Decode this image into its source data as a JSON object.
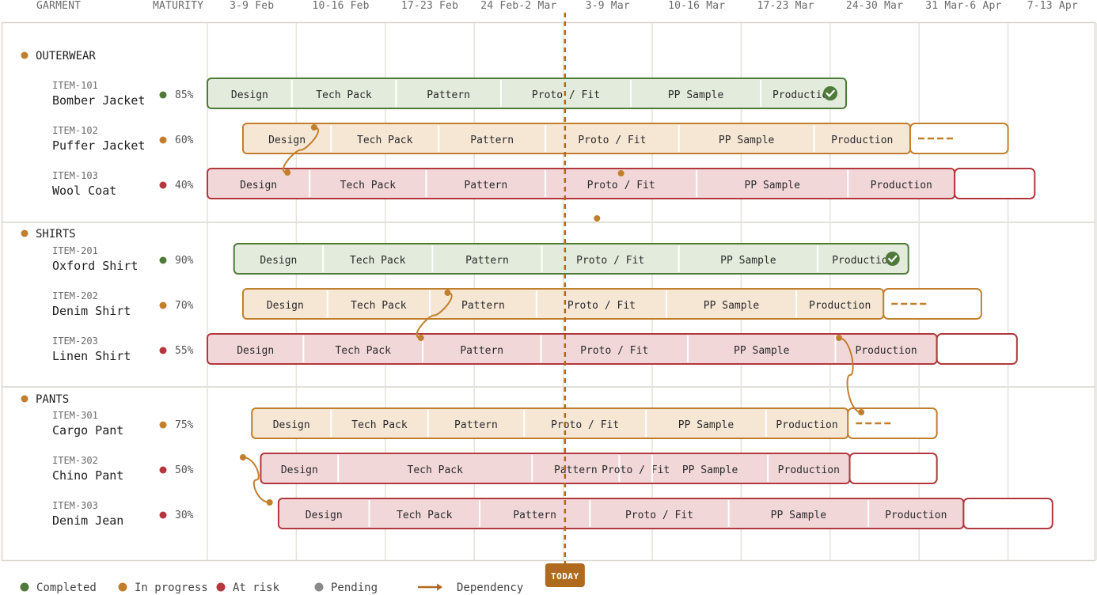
{
  "headers": {
    "garment": "GARMENT",
    "maturity": "MATURITY"
  },
  "colors": {
    "completed": "#4f7a3a",
    "completed_fill": "#e3ecdc",
    "in_progress": "#c17f2e",
    "in_progress_fill": "#f6e7d5",
    "at_risk": "#b2383d",
    "at_risk_fill": "#f2d7d9",
    "pending": "#8a8a8a",
    "grid": "#e4e2dc",
    "today": "#b06a1e"
  },
  "legend": [
    {
      "label": "Completed",
      "status": "completed"
    },
    {
      "label": "In progress",
      "status": "in_progress"
    },
    {
      "label": "At risk",
      "status": "at_risk"
    },
    {
      "label": "Pending",
      "status": "pending"
    },
    {
      "label": "Dependency",
      "status": "dependency"
    }
  ],
  "chart_data": {
    "type": "gantt",
    "x_unit": "weeks",
    "xlim": [
      0,
      10
    ],
    "weeks": [
      "3-9 Feb",
      "10-16 Feb",
      "17-23 Feb",
      "24 Feb-2 Mar",
      "3-9 Mar",
      "10-16 Mar",
      "17-23 Mar",
      "24-30 Mar",
      "31 Mar-6 Apr",
      "7-13 Apr"
    ],
    "today": {
      "label": "TODAY",
      "week": 4.02
    },
    "groups": [
      {
        "name": "OUTERWEAR",
        "items": [
          {
            "id": "ITEM-101",
            "name": "Bomber Jacket",
            "maturity": "85%",
            "status": "completed",
            "stages": [
              [
                "Design",
                0.0,
                0.95
              ],
              [
                "Tech Pack",
                0.95,
                2.12
              ],
              [
                "Pattern",
                2.12,
                3.3
              ],
              [
                "Proto / Fit",
                3.3,
                4.76
              ],
              [
                "PP Sample",
                4.76,
                6.22
              ],
              [
                "Production",
                6.22,
                7.18
              ]
            ],
            "pending": null
          },
          {
            "id": "ITEM-102",
            "name": "Puffer Jacket",
            "maturity": "60%",
            "status": "in_progress",
            "stages": [
              [
                "Design",
                0.4,
                1.39
              ],
              [
                "Tech Pack",
                1.39,
                2.6
              ],
              [
                "Pattern",
                2.6,
                3.8
              ],
              [
                "Proto / Fit",
                3.8,
                5.3
              ],
              [
                "PP Sample",
                5.3,
                6.82
              ],
              [
                "Production",
                6.82,
                7.9
              ]
            ],
            "pending": [
              7.9,
              9.0
            ]
          },
          {
            "id": "ITEM-103",
            "name": "Wool Coat",
            "maturity": "40%",
            "status": "at_risk",
            "stages": [
              [
                "Design",
                0.0,
                1.15
              ],
              [
                "Tech Pack",
                1.15,
                2.46
              ],
              [
                "Pattern",
                2.46,
                3.8
              ],
              [
                "Proto / Fit",
                3.8,
                5.5
              ],
              [
                "PP Sample",
                5.5,
                7.2
              ],
              [
                "Production",
                7.2,
                8.4
              ]
            ],
            "pending": [
              8.4,
              9.3
            ]
          }
        ]
      },
      {
        "name": "SHIRTS",
        "items": [
          {
            "id": "ITEM-201",
            "name": "Oxford Shirt",
            "maturity": "90%",
            "status": "completed",
            "stages": [
              [
                "Design",
                0.3,
                1.3
              ],
              [
                "Tech Pack",
                1.3,
                2.53
              ],
              [
                "Pattern",
                2.53,
                3.76
              ],
              [
                "Proto / Fit",
                3.76,
                5.3
              ],
              [
                "PP Sample",
                5.3,
                6.86
              ],
              [
                "Production",
                6.86,
                7.88
              ]
            ],
            "pending": null
          },
          {
            "id": "ITEM-202",
            "name": "Denim Shirt",
            "maturity": "70%",
            "status": "in_progress",
            "stages": [
              [
                "Design",
                0.4,
                1.35
              ],
              [
                "Tech Pack",
                1.35,
                2.5
              ],
              [
                "Pattern",
                2.5,
                3.7
              ],
              [
                "Proto / Fit",
                3.7,
                5.16
              ],
              [
                "PP Sample",
                5.16,
                6.62
              ],
              [
                "Production",
                6.62,
                7.6
              ]
            ],
            "pending": [
              7.6,
              8.7
            ]
          },
          {
            "id": "ITEM-203",
            "name": "Linen Shirt",
            "maturity": "55%",
            "status": "at_risk",
            "stages": [
              [
                "Design",
                0.0,
                1.08
              ],
              [
                "Tech Pack",
                1.08,
                2.42
              ],
              [
                "Pattern",
                2.42,
                3.75
              ],
              [
                "Proto / Fit",
                3.75,
                5.4
              ],
              [
                "PP Sample",
                5.4,
                7.06
              ],
              [
                "Production",
                7.06,
                8.2
              ]
            ],
            "pending": [
              8.2,
              9.1
            ]
          }
        ]
      },
      {
        "name": "PANTS",
        "items": [
          {
            "id": "ITEM-301",
            "name": "Cargo Pant",
            "maturity": "75%",
            "status": "in_progress",
            "stages": [
              [
                "Design",
                0.5,
                1.39
              ],
              [
                "Tech Pack",
                1.39,
                2.48
              ],
              [
                "Pattern",
                2.48,
                3.56
              ],
              [
                "Proto / Fit",
                3.56,
                4.93
              ],
              [
                "PP Sample",
                4.93,
                6.28
              ],
              [
                "Production",
                6.28,
                7.2
              ]
            ],
            "pending": [
              7.2,
              8.2
            ]
          },
          {
            "id": "ITEM-302",
            "name": "Chino Pant",
            "maturity": "50%",
            "status": "at_risk",
            "stages": [
              [
                "Design",
                0.6,
                1.47
              ],
              [
                "Tech Pack",
                1.47,
                3.65
              ],
              [
                "Pattern",
                3.65,
                4.63
              ],
              [
                "Proto / Fit",
                4.63,
                5.0
              ],
              [
                "PP Sample",
                5.0,
                6.3
              ],
              [
                "Production",
                6.3,
                7.22
              ]
            ],
            "pending": [
              7.22,
              8.2
            ]
          },
          {
            "id": "ITEM-303",
            "name": "Denim Jean",
            "maturity": "30%",
            "status": "at_risk",
            "stages": [
              [
                "Design",
                0.8,
                1.82
              ],
              [
                "Tech Pack",
                1.82,
                3.06
              ],
              [
                "Pattern",
                3.06,
                4.3
              ],
              [
                "Proto / Fit",
                4.3,
                5.86
              ],
              [
                "PP Sample",
                5.86,
                7.43
              ],
              [
                "Production",
                7.43,
                8.5
              ]
            ],
            "pending": [
              8.5,
              9.5
            ]
          }
        ]
      }
    ],
    "dependencies": [
      {
        "from": [
          1.2,
          1
        ],
        "to": [
          0.9,
          2
        ]
      },
      {
        "from": [
          2.7,
          4
        ],
        "to": [
          2.4,
          5
        ]
      },
      {
        "from": [
          7.1,
          5
        ],
        "to": [
          7.35,
          6
        ]
      },
      {
        "from": [
          0.4,
          7
        ],
        "to": [
          0.7,
          8
        ]
      }
    ],
    "markers": [
      {
        "week": 4.65,
        "row": 2
      },
      {
        "week": 4.38,
        "row": 2.6
      }
    ]
  }
}
